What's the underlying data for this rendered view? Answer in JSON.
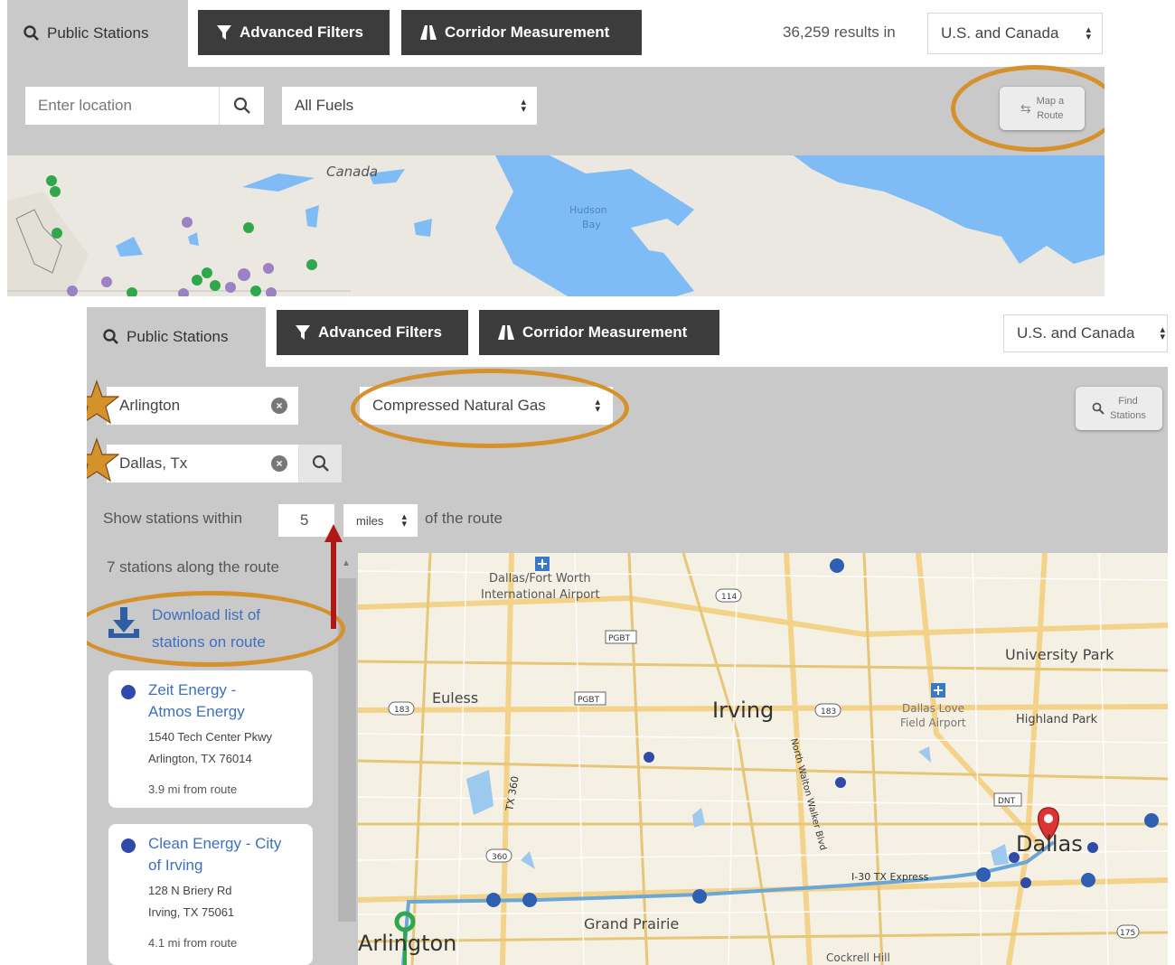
{
  "panel1": {
    "tabs": {
      "public_stations": "Public Stations",
      "advanced_filters": "Advanced Filters",
      "corridor_measurement": "Corridor Measurement"
    },
    "results_text": "36,259 results in",
    "region_select": "U.S. and Canada",
    "location_placeholder": "Enter location",
    "fuel_select": "All Fuels",
    "map_route_button": {
      "line1": "Map a",
      "line2": "Route"
    },
    "map_labels": {
      "country": "Canada",
      "bay_line1": "Hudson",
      "bay_line2": "Bay"
    }
  },
  "panel2": {
    "tabs": {
      "public_stations": "Public Stations",
      "advanced_filters": "Advanced Filters",
      "corridor_measurement": "Corridor Measurement"
    },
    "region_select": "U.S. and Canada",
    "origin_value": "Arlington",
    "destination_value": "Dallas, Tx",
    "fuel_select": "Compressed Natural Gas",
    "find_stations_button": {
      "line1": "Find",
      "line2": "Stations"
    },
    "within_prefix": "Show stations within",
    "within_value": "5",
    "unit_select": "miles",
    "within_suffix": "of the route",
    "stations_count": "7 stations along the route",
    "download": {
      "line1": "Download list of",
      "line2": "stations on route"
    },
    "stations": [
      {
        "name_line1": "Zeit Energy -",
        "name_line2": "Atmos Energy",
        "address_line1": "1540 Tech Center Pkwy",
        "address_line2": "Arlington, TX 76014",
        "distance": "3.9 mi from route"
      },
      {
        "name_line1": "Clean Energy - City",
        "name_line2": "of Irving",
        "address_line1": "128 N Briery Rd",
        "address_line2": "Irving, TX 75061",
        "distance": "4.1 mi from route"
      }
    ],
    "map_labels": {
      "airport_line1": "Dallas/Fort Worth",
      "airport_line2": "International Airport",
      "euless": "Euless",
      "irving": "Irving",
      "university_park": "University Park",
      "highland_park": "Highland Park",
      "love_field_line1": "Dallas Love",
      "love_field_line2": "Field Airport",
      "dallas": "Dallas",
      "grand_prairie": "Grand Prairie",
      "arlington": "Arlington",
      "cockrell_hill": "Cockrell Hill",
      "road_114": "114",
      "road_183a": "183",
      "road_183b": "183",
      "road_pgbt1": "PGBT",
      "road_pgbt2": "PGBT",
      "road_dnt": "DNT",
      "road_360": "360",
      "road_tx360": "TX 360",
      "road_30": "I-30 TX Express",
      "road_nw": "North Walton Walker Blvd",
      "road_175": "175"
    }
  },
  "colors": {
    "accent_orange": "#d5912c",
    "tab_dark": "#3c3c3c",
    "band_gray": "#c9c9c9",
    "station_blue": "#2f4aa8",
    "route_blue": "#6aa6d6",
    "water": "#7fbcf5"
  }
}
